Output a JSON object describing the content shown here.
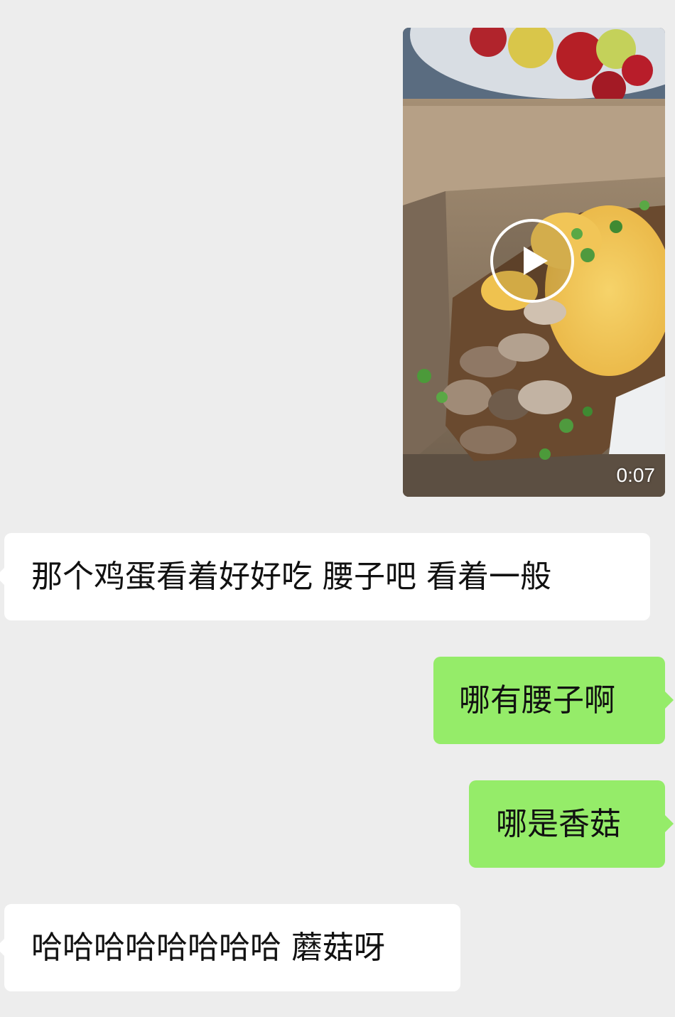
{
  "chat": {
    "background": "#ededed",
    "bubble_incoming_color": "#ffffff",
    "bubble_outgoing_color": "#95ec69",
    "messages": [
      {
        "type": "video",
        "direction": "outgoing",
        "duration": "0:07",
        "icon": "play-icon"
      },
      {
        "type": "text",
        "direction": "incoming",
        "text": "那个鸡蛋看着好好吃 腰子吧 看着一般"
      },
      {
        "type": "text",
        "direction": "outgoing",
        "text": "哪有腰子啊"
      },
      {
        "type": "text",
        "direction": "outgoing",
        "text": "哪是香菇"
      },
      {
        "type": "text",
        "direction": "incoming",
        "text": "哈哈哈哈哈哈哈哈 蘑菇呀"
      }
    ]
  }
}
